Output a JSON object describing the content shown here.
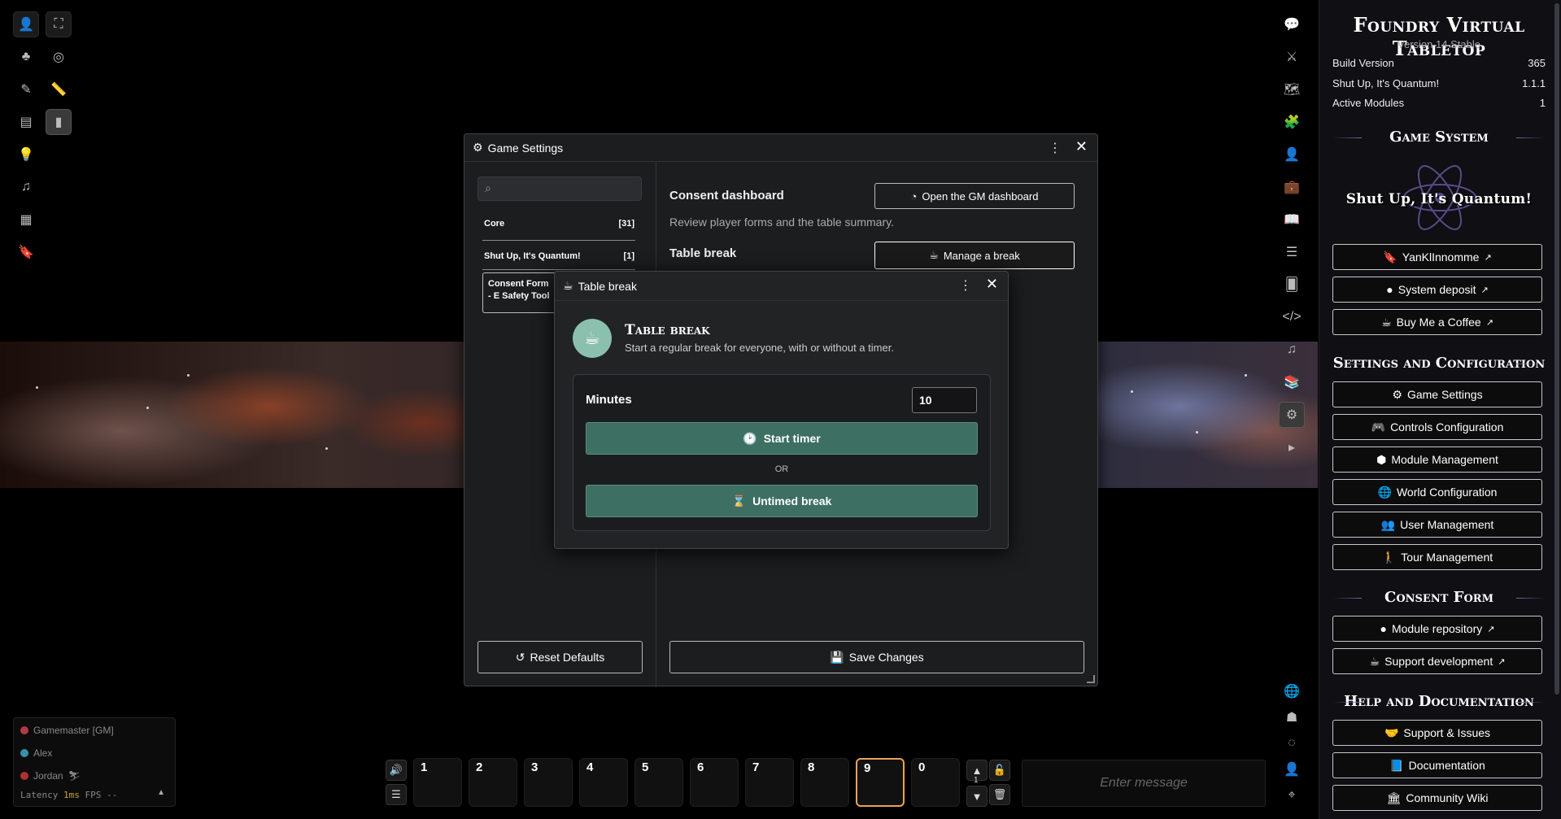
{
  "sidebar": {
    "title": "Foundry Virtual Tabletop",
    "version": "Version 14 Stable",
    "info": [
      {
        "label": "Build Version",
        "value": "365"
      },
      {
        "label": "Shut Up, It's Quantum!",
        "value": "1.1.1"
      },
      {
        "label": "Active Modules",
        "value": "1"
      }
    ],
    "game_system_heading": "Game System",
    "logo_text": "Shut Up, It's Quantum!",
    "system_links": [
      "YanKlInnomme",
      "System deposit",
      "Buy Me a Coffee"
    ],
    "settings_heading": "Settings and Configuration",
    "settings_buttons": [
      "Game Settings",
      "Controls Configuration",
      "Module Management",
      "World Configuration",
      "User Management",
      "Tour Management"
    ],
    "consent_heading": "Consent Form",
    "consent_links": [
      "Module repository",
      "Support development"
    ],
    "help_heading": "Help and Documentation",
    "help_links": [
      "Support & Issues",
      "Documentation",
      "Community Wiki"
    ]
  },
  "game_settings": {
    "title": "Game Settings",
    "search_placeholder": "",
    "categories": [
      {
        "label": "Core",
        "count": "[31]"
      },
      {
        "label": "Shut Up, It's Quantum!",
        "count": "[1]"
      }
    ],
    "selected_category": "Consent Form - E Safety Tool",
    "consent_dashboard_label": "Consent dashboard",
    "open_dashboard_button": "Open the GM dashboard",
    "consent_dashboard_hint": "Review player forms and the table summary.",
    "table_break_label": "Table break",
    "manage_break_button": "Manage a break",
    "reset_button": "Reset Defaults",
    "save_button": "Save Changes"
  },
  "table_break": {
    "window_title": "Table break",
    "heading": "Table break",
    "subtitle": "Start a regular break for everyone, with or without a timer.",
    "minutes_label": "Minutes",
    "minutes_value": "10",
    "start_timer_button": "Start timer",
    "or_text": "OR",
    "untimed_button": "Untimed break"
  },
  "players": {
    "list": [
      {
        "name": "Gamemaster [GM]",
        "color": "#b03a48"
      },
      {
        "name": "Alex",
        "color": "#3a8fa8"
      },
      {
        "name": "Jordan",
        "color": "#b03030"
      }
    ],
    "latency_label": "Latency",
    "latency_value": "1ms",
    "fps_label": "FPS",
    "fps_value": "--"
  },
  "hotbar": {
    "slots": [
      "1",
      "2",
      "3",
      "4",
      "5",
      "6",
      "7",
      "8",
      "9",
      "0"
    ],
    "active_slot": "9",
    "page": "1"
  },
  "chat": {
    "placeholder": "Enter message"
  },
  "colors": {
    "accent_green": "#3d6f63",
    "icon_teal": "#8bbfae",
    "hotbar_active": "#e8a357"
  }
}
